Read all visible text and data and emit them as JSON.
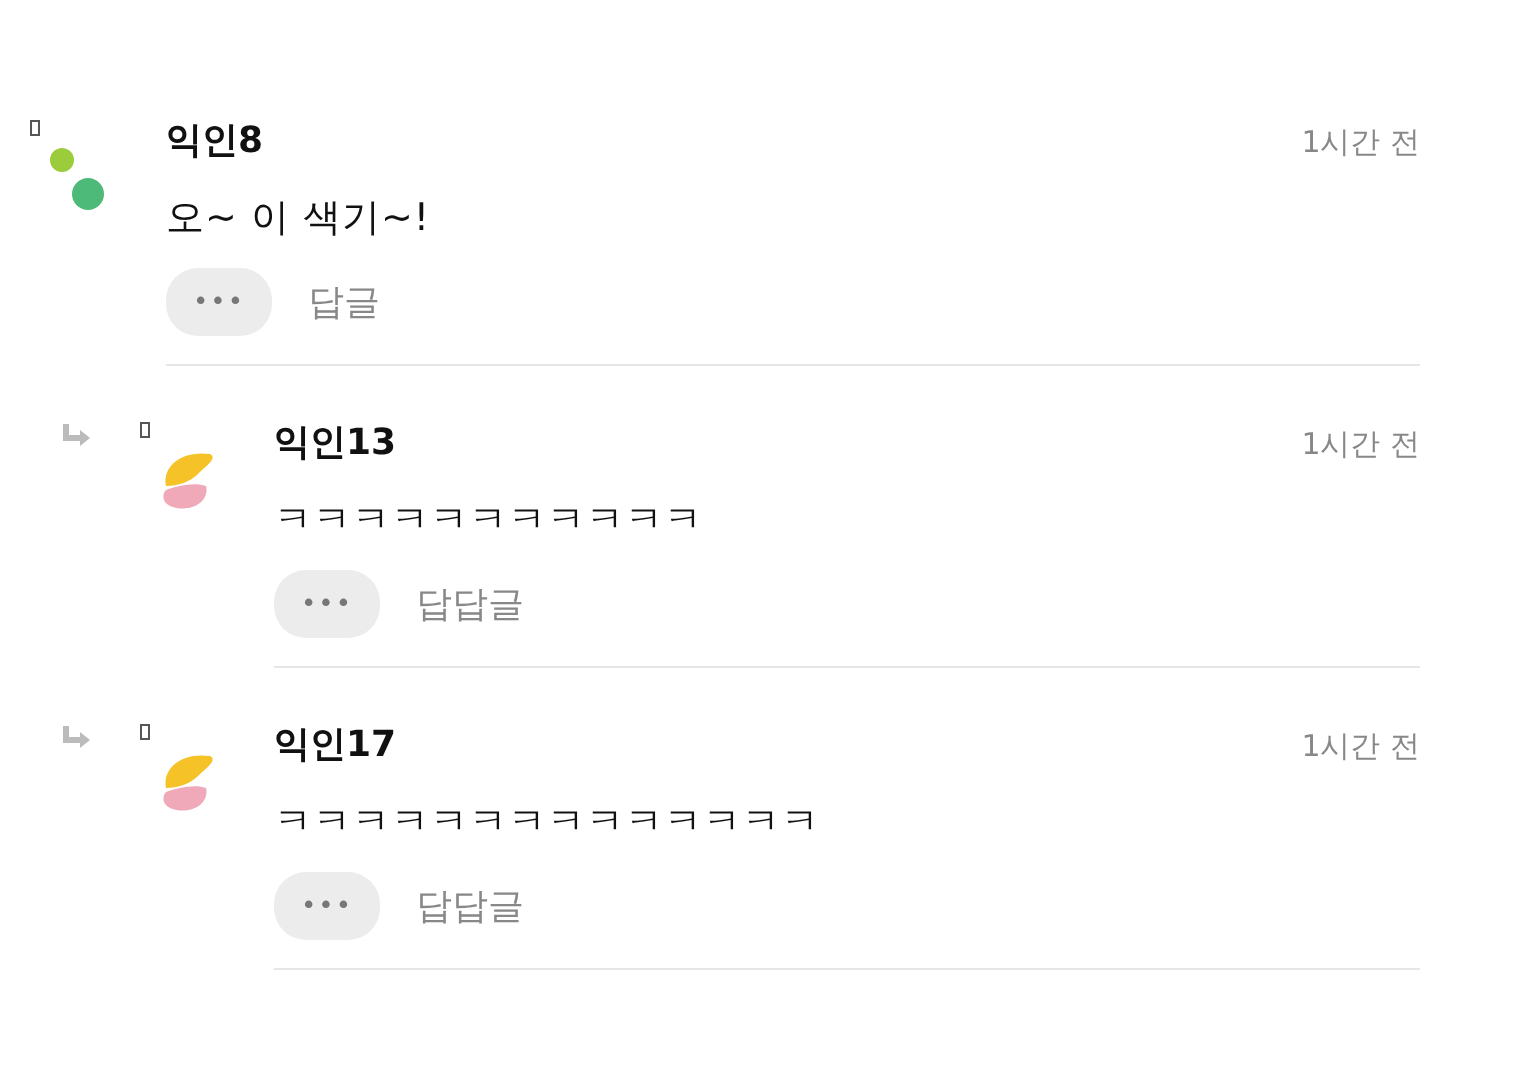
{
  "comments": [
    {
      "kind": "comment",
      "avatar": {
        "kind": "dots"
      },
      "author": "익인8",
      "time": "1시간 전",
      "text": "오~ 이 색기~!",
      "more": "•••",
      "reply": "답글"
    },
    {
      "kind": "reply",
      "avatar": {
        "kind": "blob"
      },
      "author": "익인13",
      "time": "1시간 전",
      "text": "ㅋㅋㅋㅋㅋㅋㅋㅋㅋㅋㅋ",
      "more": "•••",
      "reply": "답답글"
    },
    {
      "kind": "reply",
      "avatar": {
        "kind": "blob"
      },
      "author": "익인17",
      "time": "1시간 전",
      "text": "ㅋㅋㅋㅋㅋㅋㅋㅋㅋㅋㅋㅋㅋㅋ",
      "more": "•••",
      "reply": "답답글"
    }
  ]
}
